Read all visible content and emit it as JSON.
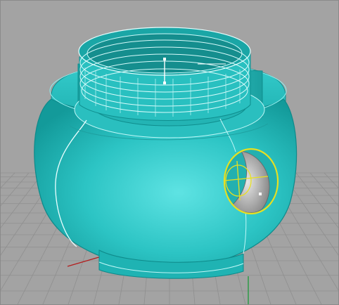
{
  "app": {
    "view": "Perspective"
  },
  "viewport": {
    "background_color": "#a3a3a3",
    "grid_color": "#8f8f8f",
    "grid_major_color": "#808080",
    "x_axis_color": "#b41e1e",
    "y_axis_color": "#1e9a3a"
  },
  "model": {
    "object": "jar-with-threaded-neck",
    "surface_color": "#2ec9c9",
    "edge_highlight_color": "#bff7f7",
    "selection_color": "#e8e020",
    "selected_feature": "side-opening"
  }
}
